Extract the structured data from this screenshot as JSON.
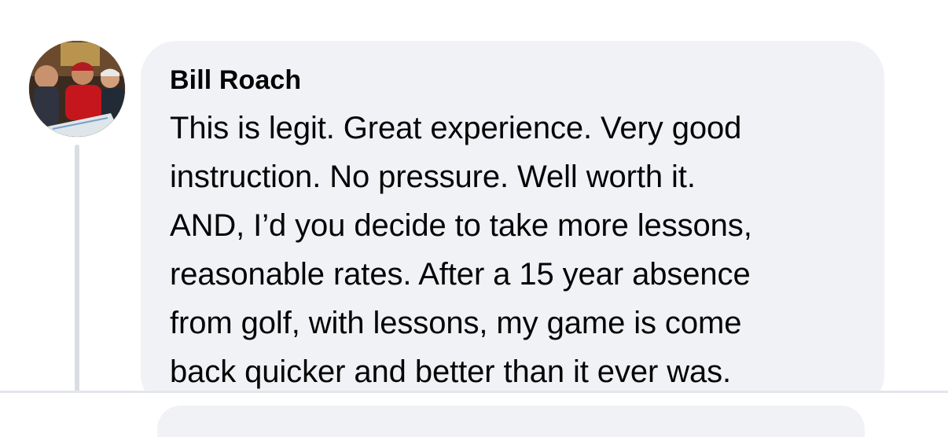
{
  "comment": {
    "author": "Bill Roach",
    "avatar_icon": "profile-photo-avatar",
    "text": "This is legit. Great experience. Very  good\ninstruction. No pressure. Well worth it.\nAND, I’d you decide to take more lessons,\nreasonable rates. After a 15 year absence\nfrom golf, with lessons, my game is come\nback quicker and better than it ever was."
  },
  "colors": {
    "bubble_background": "#f0f2f5",
    "thread_line": "#dadde1",
    "text": "#050505"
  }
}
